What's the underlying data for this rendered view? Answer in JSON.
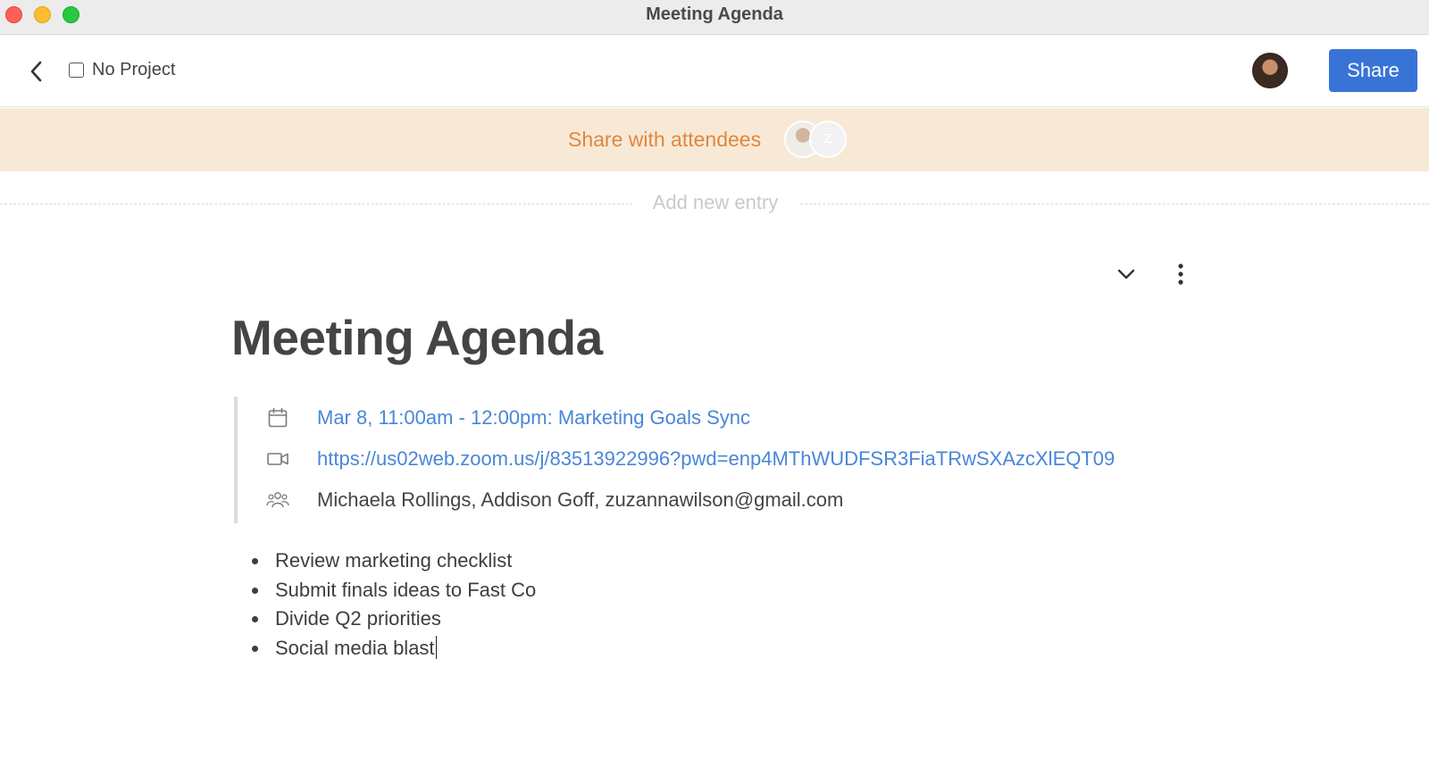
{
  "window": {
    "title": "Meeting Agenda",
    "controls": [
      "close",
      "minimize",
      "maximize"
    ]
  },
  "toolbar": {
    "back_icon": "chevron-left-icon",
    "project_checked": false,
    "project_label": "No Project",
    "share_label": "Share"
  },
  "banner": {
    "text": "Share with attendees",
    "second_attendee_initial": "Z",
    "background": "#f8e9d6",
    "text_color": "#e0873f"
  },
  "entry": {
    "add_label": "Add new entry"
  },
  "document": {
    "title": "Meeting Agenda",
    "event": {
      "calendar_icon": "calendar-icon",
      "datetime": "Mar 8, 11:00am - 12:00pm: Marketing Goals Sync",
      "video_icon": "video-camera-icon",
      "meeting_link": "https://us02web.zoom.us/j/83513922996?pwd=enp4MThWUDFSR3FiaTRwSXAzcXlEQT09",
      "attendees_icon": "people-icon",
      "attendees": "Michaela Rollings, Addison Goff, zuzannawilson@gmail.com"
    },
    "agenda_items": [
      "Review marketing checklist",
      "Submit finals ideas to Fast Co",
      "Divide Q2 priorities",
      "Social media blast"
    ]
  },
  "colors": {
    "accent": "#3873d6",
    "link": "#4a86d8"
  }
}
